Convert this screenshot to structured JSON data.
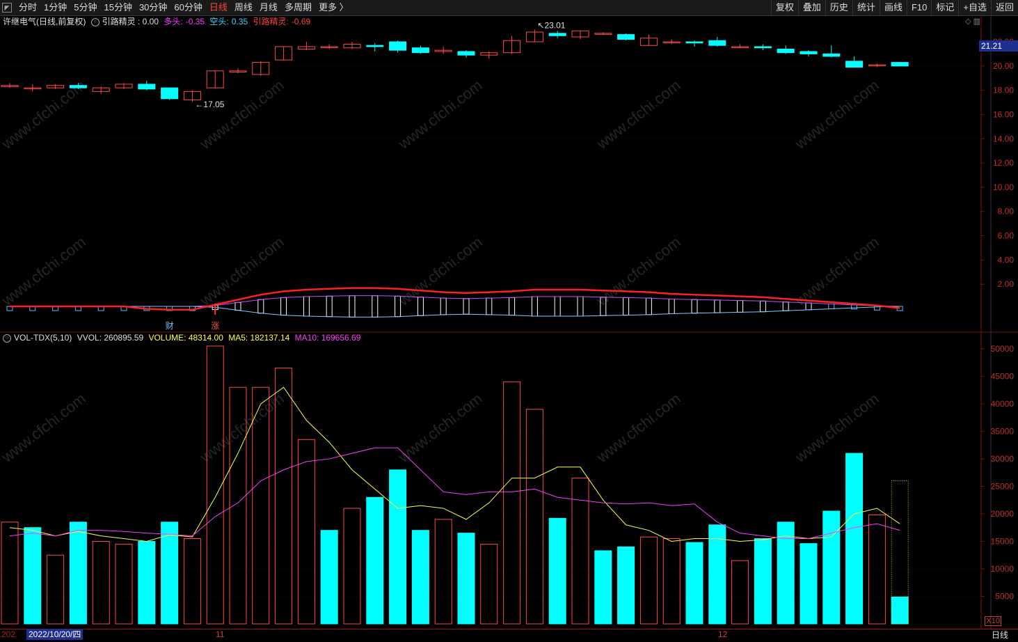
{
  "toolbar": {
    "periods": [
      "分时",
      "1分钟",
      "5分钟",
      "15分钟",
      "30分钟",
      "60分钟",
      "日线",
      "周线",
      "月线",
      "多周期",
      "更多 〉"
    ],
    "active_period": "日线",
    "tools": [
      "复权",
      "叠加",
      "历史",
      "统计",
      "画线",
      "F10",
      "标记",
      "+自选",
      "返回"
    ]
  },
  "header": {
    "stock": "许继电气(日线,前复权)",
    "indicator_label": "引路精灵 : 0.00",
    "duo_label": "多头:",
    "duo_value": "-0.35",
    "kong_label": "空头:",
    "kong_value": "0.35",
    "ylj_label": "引路精灵:",
    "ylj_value": "-0.69"
  },
  "price_axis": {
    "ticks": [
      "22.00",
      "20.00",
      "18.00",
      "16.00",
      "14.00",
      "12.00",
      "10.00",
      "8.00",
      "6.00",
      "4.00",
      "2.00"
    ],
    "current": "21.21"
  },
  "annotations": {
    "high": "23.01",
    "low": "17.05",
    "cai": "财",
    "zhang": "涨"
  },
  "volume_header": {
    "name": "VOL-TDX(5,10)",
    "vvol": "VVOL: 260895.59",
    "volume": "VOLUME: 48314.00",
    "ma5": "MA5: 182137.14",
    "ma10": "MA10: 169656.69"
  },
  "volume_axis": {
    "ticks": [
      "50000",
      "45000",
      "40000",
      "35000",
      "30000",
      "25000",
      "20000",
      "15000",
      "10000",
      "5000"
    ],
    "multiplier": "X10"
  },
  "bottom": {
    "zz": "202",
    "date": "2022/10/20/四",
    "nov": "11",
    "dec": "12",
    "period": "日线"
  },
  "watermark": "www.cfchi.com",
  "colors": {
    "up": "#ff4a4a",
    "down": "#00ffff",
    "ma5": "#ffff40",
    "ma10": "#ff3cff",
    "red_line": "#ff2020",
    "grid": "#7a1010"
  },
  "chart_data": [
    {
      "type": "candlestick",
      "title": "许继电气(日线,前复权)",
      "ylim": [
        0,
        23.5
      ],
      "candles": [
        {
          "o": 18.3,
          "c": 18.4,
          "h": 18.6,
          "l": 18.2
        },
        {
          "o": 18.2,
          "c": 18.2,
          "h": 18.5,
          "l": 17.9
        },
        {
          "o": 18.2,
          "c": 18.4,
          "h": 18.5,
          "l": 18.1
        },
        {
          "o": 18.4,
          "c": 18.2,
          "h": 18.6,
          "l": 18.1
        },
        {
          "o": 17.9,
          "c": 18.2,
          "h": 18.3,
          "l": 17.7
        },
        {
          "o": 18.2,
          "c": 18.5,
          "h": 18.6,
          "l": 18.1
        },
        {
          "o": 18.5,
          "c": 18.1,
          "h": 18.8,
          "l": 18.0
        },
        {
          "o": 18.2,
          "c": 17.3,
          "h": 18.2,
          "l": 17.2
        },
        {
          "o": 17.2,
          "c": 17.9,
          "h": 18.0,
          "l": 17.05
        },
        {
          "o": 18.2,
          "c": 19.6,
          "h": 19.6,
          "l": 18.2
        },
        {
          "o": 19.5,
          "c": 19.6,
          "h": 19.8,
          "l": 19.4
        },
        {
          "o": 19.3,
          "c": 20.3,
          "h": 20.4,
          "l": 19.2
        },
        {
          "o": 20.5,
          "c": 21.6,
          "h": 21.6,
          "l": 20.5
        },
        {
          "o": 21.4,
          "c": 21.6,
          "h": 22.0,
          "l": 21.3
        },
        {
          "o": 21.6,
          "c": 21.6,
          "h": 21.8,
          "l": 21.4
        },
        {
          "o": 21.5,
          "c": 21.8,
          "h": 22.0,
          "l": 21.4
        },
        {
          "o": 21.7,
          "c": 21.6,
          "h": 21.9,
          "l": 21.2
        },
        {
          "o": 22.0,
          "c": 21.3,
          "h": 22.1,
          "l": 21.1
        },
        {
          "o": 21.5,
          "c": 21.1,
          "h": 21.7,
          "l": 21.0
        },
        {
          "o": 21.2,
          "c": 21.3,
          "h": 21.6,
          "l": 21.0
        },
        {
          "o": 21.2,
          "c": 20.9,
          "h": 21.3,
          "l": 20.7
        },
        {
          "o": 20.9,
          "c": 21.1,
          "h": 21.2,
          "l": 20.6
        },
        {
          "o": 21.1,
          "c": 22.1,
          "h": 22.5,
          "l": 21.0
        },
        {
          "o": 22.0,
          "c": 22.8,
          "h": 23.01,
          "l": 22.0
        },
        {
          "o": 22.7,
          "c": 22.5,
          "h": 22.9,
          "l": 22.3
        },
        {
          "o": 22.4,
          "c": 22.9,
          "h": 22.9,
          "l": 22.2
        },
        {
          "o": 22.7,
          "c": 22.7,
          "h": 22.8,
          "l": 22.6
        },
        {
          "o": 22.6,
          "c": 22.2,
          "h": 22.7,
          "l": 22.1
        },
        {
          "o": 21.7,
          "c": 22.3,
          "h": 22.6,
          "l": 21.7
        },
        {
          "o": 22.0,
          "c": 22.0,
          "h": 22.2,
          "l": 21.8
        },
        {
          "o": 22.0,
          "c": 21.9,
          "h": 22.1,
          "l": 21.6
        },
        {
          "o": 22.1,
          "c": 21.7,
          "h": 22.4,
          "l": 21.6
        },
        {
          "o": 21.6,
          "c": 21.6,
          "h": 21.8,
          "l": 21.5
        },
        {
          "o": 21.6,
          "c": 21.5,
          "h": 21.8,
          "l": 21.3
        },
        {
          "o": 21.4,
          "c": 21.1,
          "h": 21.7,
          "l": 21.0
        },
        {
          "o": 21.2,
          "c": 21.0,
          "h": 21.3,
          "l": 20.8
        },
        {
          "o": 21.0,
          "c": 20.8,
          "h": 21.7,
          "l": 20.7
        },
        {
          "o": 20.4,
          "c": 19.9,
          "h": 20.8,
          "l": 19.9
        },
        {
          "o": 20.1,
          "c": 20.1,
          "h": 20.2,
          "l": 19.9
        },
        {
          "o": 20.3,
          "c": 20.0,
          "h": 20.3,
          "l": 20.0
        }
      ]
    },
    {
      "type": "bar",
      "title": "VOL-TDX(5,10)",
      "ylim": [
        0,
        51000
      ],
      "values": [
        18500,
        17500,
        12500,
        18500,
        15000,
        14500,
        15000,
        18500,
        15500,
        50500,
        43000,
        43000,
        46500,
        33500,
        17000,
        21000,
        23000,
        28000,
        17000,
        19000,
        16500,
        14500,
        44000,
        39000,
        19200,
        26500,
        13300,
        14000,
        15800,
        15500,
        14800,
        18000,
        11500,
        15500,
        18500,
        14600,
        20500,
        31000,
        19800,
        4900
      ],
      "up": [
        true,
        false,
        true,
        false,
        true,
        true,
        false,
        false,
        true,
        true,
        true,
        true,
        true,
        true,
        false,
        true,
        false,
        false,
        false,
        true,
        false,
        true,
        true,
        true,
        false,
        true,
        false,
        false,
        true,
        true,
        false,
        false,
        true,
        false,
        false,
        false,
        false,
        false,
        true,
        false
      ],
      "pending_total": 26000,
      "ma5": [
        17500,
        17000,
        16000,
        16800,
        16000,
        15500,
        15000,
        16200,
        15800,
        23000,
        31000,
        40000,
        43000,
        37000,
        33000,
        28000,
        24500,
        21000,
        21500,
        21000,
        19000,
        22000,
        26500,
        26500,
        28500,
        28500,
        22500,
        18000,
        17000,
        15000,
        15500,
        15500,
        15000,
        15300,
        16000,
        15500,
        15800,
        20000,
        21000,
        18200
      ],
      "ma10": [
        16000,
        16500,
        16000,
        17000,
        17000,
        16800,
        16500,
        16300,
        16000,
        19500,
        22000,
        26000,
        28000,
        29500,
        30000,
        31000,
        32000,
        32000,
        28000,
        24000,
        23500,
        24000,
        24000,
        24500,
        23000,
        22500,
        22000,
        21800,
        22000,
        21500,
        21800,
        18500,
        16500,
        16000,
        15500,
        15500,
        16500,
        17500,
        18200,
        17000
      ]
    }
  ]
}
